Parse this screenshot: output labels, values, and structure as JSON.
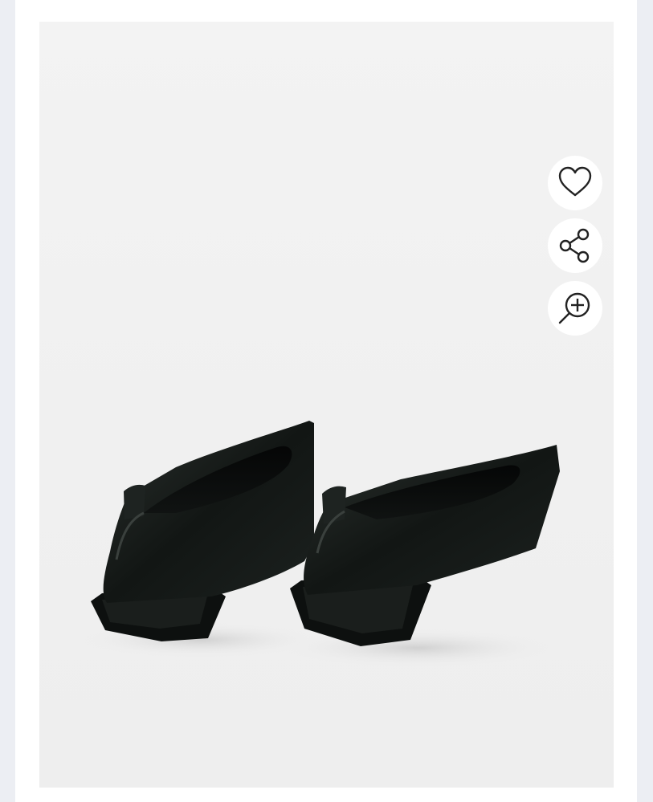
{
  "product": {
    "image_name": "black-pointed-flat-shoes"
  },
  "actions": [
    {
      "name": "favorite",
      "icon": "heart-icon"
    },
    {
      "name": "share",
      "icon": "share-icon"
    },
    {
      "name": "zoom",
      "icon": "zoom-in-icon"
    }
  ],
  "colors": {
    "page_background": "#eceef3",
    "card_background": "#ffffff",
    "image_background": "#f0f0f0",
    "icon_color": "#222222",
    "shoe_color": "#141816"
  }
}
